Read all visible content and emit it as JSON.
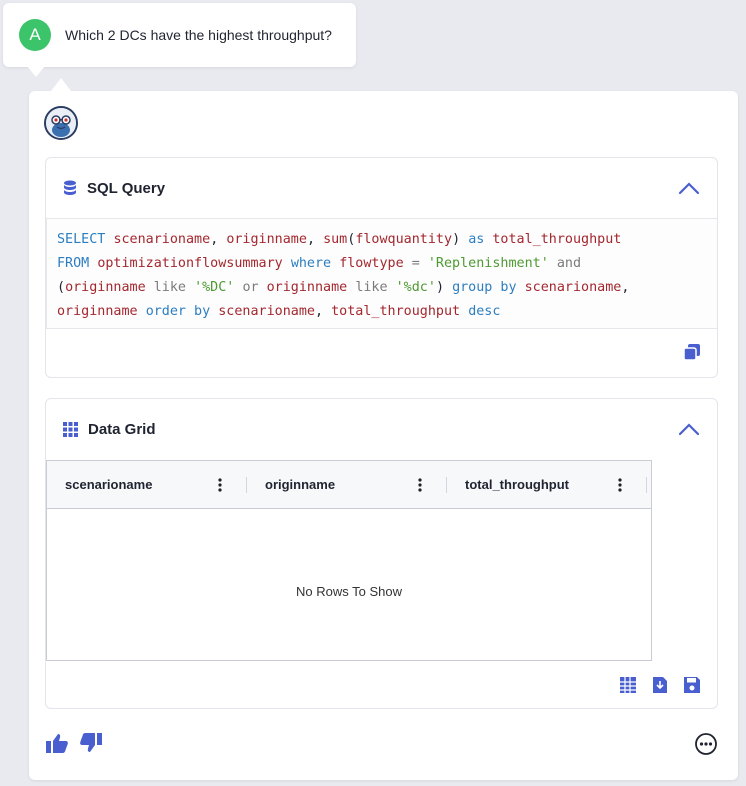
{
  "question": {
    "avatar_letter": "A",
    "text": "Which 2 DCs have the highest throughput?"
  },
  "sql_section": {
    "title": "SQL Query",
    "icon": "database-icon",
    "query": "SELECT scenarioname, originname, sum(flowquantity) as total_throughput FROM optimizationflowsummary where flowtype = 'Replenishment' and (originname like '%DC' or originname like '%dc') group by scenarioname, originname order by scenarioname, total_throughput desc"
  },
  "grid_section": {
    "title": "Data Grid",
    "icon": "grid-icon",
    "columns": [
      "scenarioname",
      "originname",
      "total_throughput"
    ],
    "empty_text": "No Rows To Show"
  },
  "colors": {
    "accent": "#4a5fcf",
    "avatar_green": "#3cc46a",
    "keyword": "#2c7ec0",
    "identifier": "#a3282e",
    "string": "#4d9a31"
  }
}
